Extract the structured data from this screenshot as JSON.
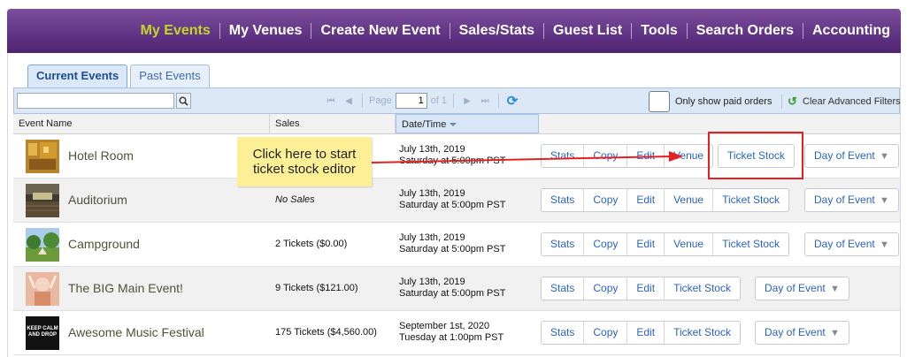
{
  "nav": {
    "items": [
      "My Events",
      "My Venues",
      "Create New Event",
      "Sales/Stats",
      "Guest List",
      "Tools",
      "Search Orders",
      "Accounting"
    ],
    "active_index": 0
  },
  "tabs": [
    {
      "label": "Current Events",
      "active": true
    },
    {
      "label": "Past Events",
      "active": false
    }
  ],
  "toolbar": {
    "search_value": "",
    "page_label": "Page",
    "page_value": "1",
    "page_of": "of 1",
    "paid_only_label": "Only show paid orders",
    "clear_filters_label": "Clear Advanced Filters"
  },
  "columns": {
    "name": "Event Name",
    "sales": "Sales",
    "date": "Date/Time"
  },
  "events": [
    {
      "name": "Hotel Room",
      "sales": "",
      "date_line1": "July 13th, 2019",
      "date_line2": "Saturday at 5:00pm PST",
      "actions": [
        "Stats",
        "Copy",
        "Edit",
        "Venue",
        "Ticket Stock"
      ],
      "thumb_icon": "hotel-room-thumb"
    },
    {
      "name": "Auditorium",
      "sales": "No Sales",
      "date_line1": "July 13th, 2019",
      "date_line2": "Saturday at 5:00pm PST",
      "actions": [
        "Stats",
        "Copy",
        "Edit",
        "Venue",
        "Ticket Stock"
      ],
      "thumb_icon": "auditorium-thumb"
    },
    {
      "name": "Campground",
      "sales": "2 Tickets ($0.00)",
      "date_line1": "July 13th, 2019",
      "date_line2": "Saturday at 5:00pm PST",
      "actions": [
        "Stats",
        "Copy",
        "Edit",
        "Venue",
        "Ticket Stock"
      ],
      "thumb_icon": "campground-thumb"
    },
    {
      "name": "The BIG Main Event!",
      "sales": "9 Tickets ($121.00)",
      "date_line1": "July 13th, 2019",
      "date_line2": "Saturday at 5:00pm PST",
      "actions": [
        "Stats",
        "Copy",
        "Edit",
        "Ticket Stock"
      ],
      "thumb_icon": "main-event-thumb"
    },
    {
      "name": "Awesome Music Festival",
      "sales": "175 Tickets ($4,560.00)",
      "date_line1": "September 1st, 2020",
      "date_line2": "Tuesday at 1:00pm PST",
      "actions": [
        "Stats",
        "Copy",
        "Edit",
        "Ticket Stock"
      ],
      "thumb_icon": "keep-calm-thumb",
      "thumb_text": "KEEP CALM AND DROP"
    }
  ],
  "day_of_event_label": "Day of Event",
  "callout_text": "Click here to start ticket stock editor",
  "colors": {
    "nav_bg": "#5b2f7f",
    "nav_active": "#c5d62b",
    "link": "#2b63c5",
    "callout_bg": "#fdef96",
    "annotation_red": "#e52020"
  }
}
